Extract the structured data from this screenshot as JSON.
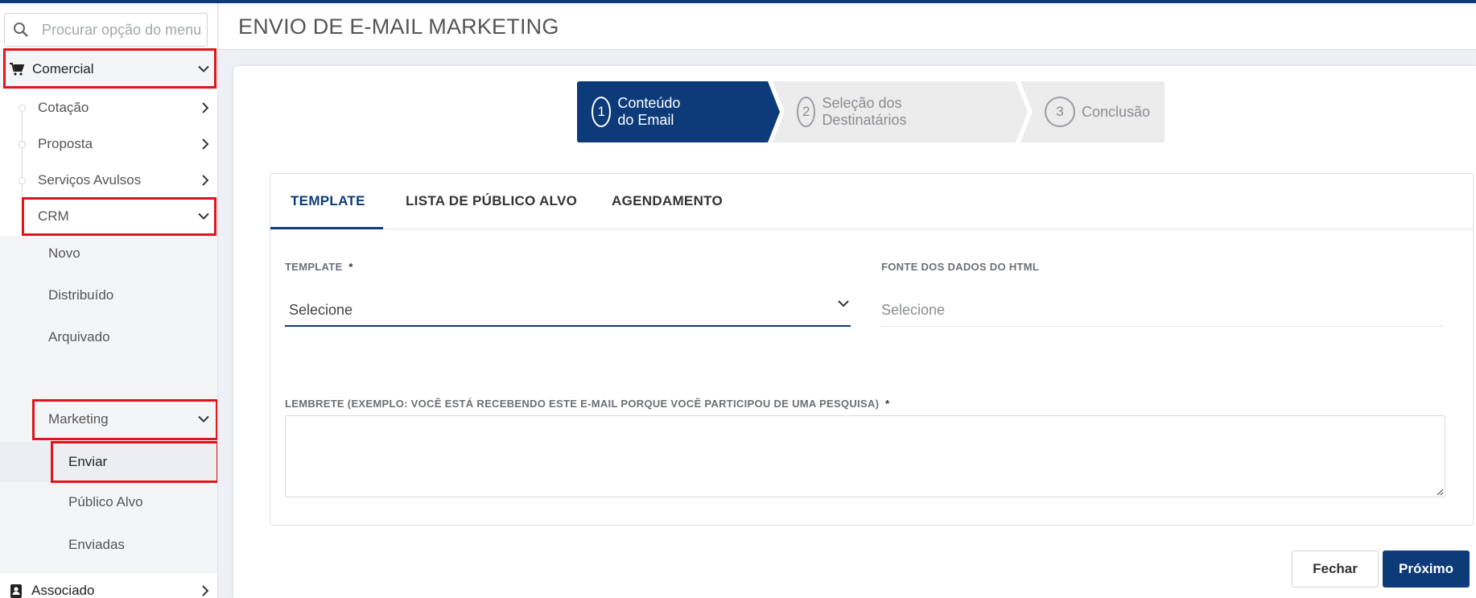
{
  "header": {
    "title": "ENVIO DE E-MAIL MARKETING"
  },
  "sidebar": {
    "search_placeholder": "Procurar opção do menu",
    "comercial": "Comercial",
    "cotacao": "Cotação",
    "proposta": "Proposta",
    "servicos": "Serviços Avulsos",
    "crm": "CRM",
    "novo": "Novo",
    "distribuido": "Distribuído",
    "arquivado": "Arquivado",
    "marketing": "Marketing",
    "enviar": "Enviar",
    "publico": "Público Alvo",
    "enviadas": "Enviadas",
    "associado": "Associado"
  },
  "stepper": {
    "steps": [
      {
        "num": "1",
        "label": "Conteúdo do Email"
      },
      {
        "num": "2",
        "label": "Seleção dos Destinatários"
      },
      {
        "num": "3",
        "label": "Conclusão"
      }
    ]
  },
  "tabs": [
    "TEMPLATE",
    "LISTA DE PÚBLICO ALVO",
    "AGENDAMENTO"
  ],
  "form": {
    "template_label": "TEMPLATE",
    "required_mark": "*",
    "template_value": "Selecione",
    "fonte_label": "FONTE DOS DADOS DO HTML",
    "fonte_value": "Selecione",
    "lembrete_label": "LEMBRETE (EXEMPLO: VOCÊ ESTÁ RECEBENDO ESTE E-MAIL PORQUE VOCÊ PARTICIPOU DE UMA PESQUISA)"
  },
  "buttons": {
    "close": "Fechar",
    "next": "Próximo"
  },
  "colors": {
    "primary": "#0d3b7a",
    "highlight": "#e0151b"
  }
}
